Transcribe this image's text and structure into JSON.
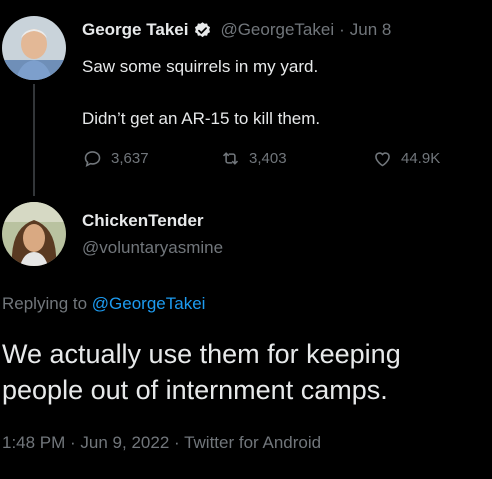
{
  "parent_tweet": {
    "author_name": "George Takei",
    "verified": true,
    "handle": "@GeorgeTakei",
    "separator": "·",
    "date": "Jun 8",
    "line1": "Saw some squirrels in my yard.",
    "line2": "Didn’t get an AR-15 to kill them.",
    "actions": {
      "replies": "3,637",
      "retweets": "3,403",
      "likes": "44.9K"
    }
  },
  "reply_tweet": {
    "author_name": "ChickenTender",
    "handle": "@voluntaryasmine",
    "replying_to_label": "Replying to",
    "replying_to_handle": "@GeorgeTakei",
    "text_line1": "We actually use them for keeping",
    "text_line2": "people out of internment camps.",
    "timestamp": "1:48 PM · Jun 9, 2022 · Twitter for Android"
  },
  "colors": {
    "background": "#000000",
    "text": "#e7e9ea",
    "muted": "#71767b",
    "link": "#1d9bf0",
    "thread_line": "#333639"
  }
}
